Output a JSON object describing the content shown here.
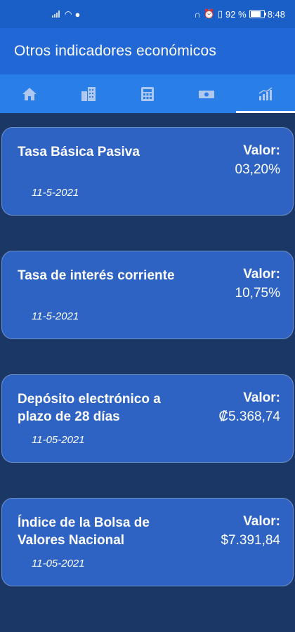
{
  "status": {
    "battery_percent": "92 %",
    "battery_level": 0.92,
    "time": "8:48"
  },
  "app_bar": {
    "title": "Otros indicadores económicos"
  },
  "tabs": [
    {
      "icon": "home-icon"
    },
    {
      "icon": "building-icon"
    },
    {
      "icon": "calculator-icon"
    },
    {
      "icon": "money-icon"
    },
    {
      "icon": "chart-icon",
      "active": true
    }
  ],
  "cards": [
    {
      "title": "Tasa Básica Pasiva",
      "label": "Valor:",
      "value": "03,20%",
      "date": "11-5-2021"
    },
    {
      "title": "Tasa de interés corriente",
      "label": "Valor:",
      "value": "10,75%",
      "date": "11-5-2021"
    },
    {
      "title": "Depósito electrónico a plazo de 28 días",
      "label": "Valor:",
      "value": "₡5.368,74",
      "date": "11-05-2021"
    },
    {
      "title": "Índice de la Bolsa de Valores Nacional",
      "label": "Valor:",
      "value": "$7.391,84",
      "date": "11-05-2021"
    }
  ]
}
